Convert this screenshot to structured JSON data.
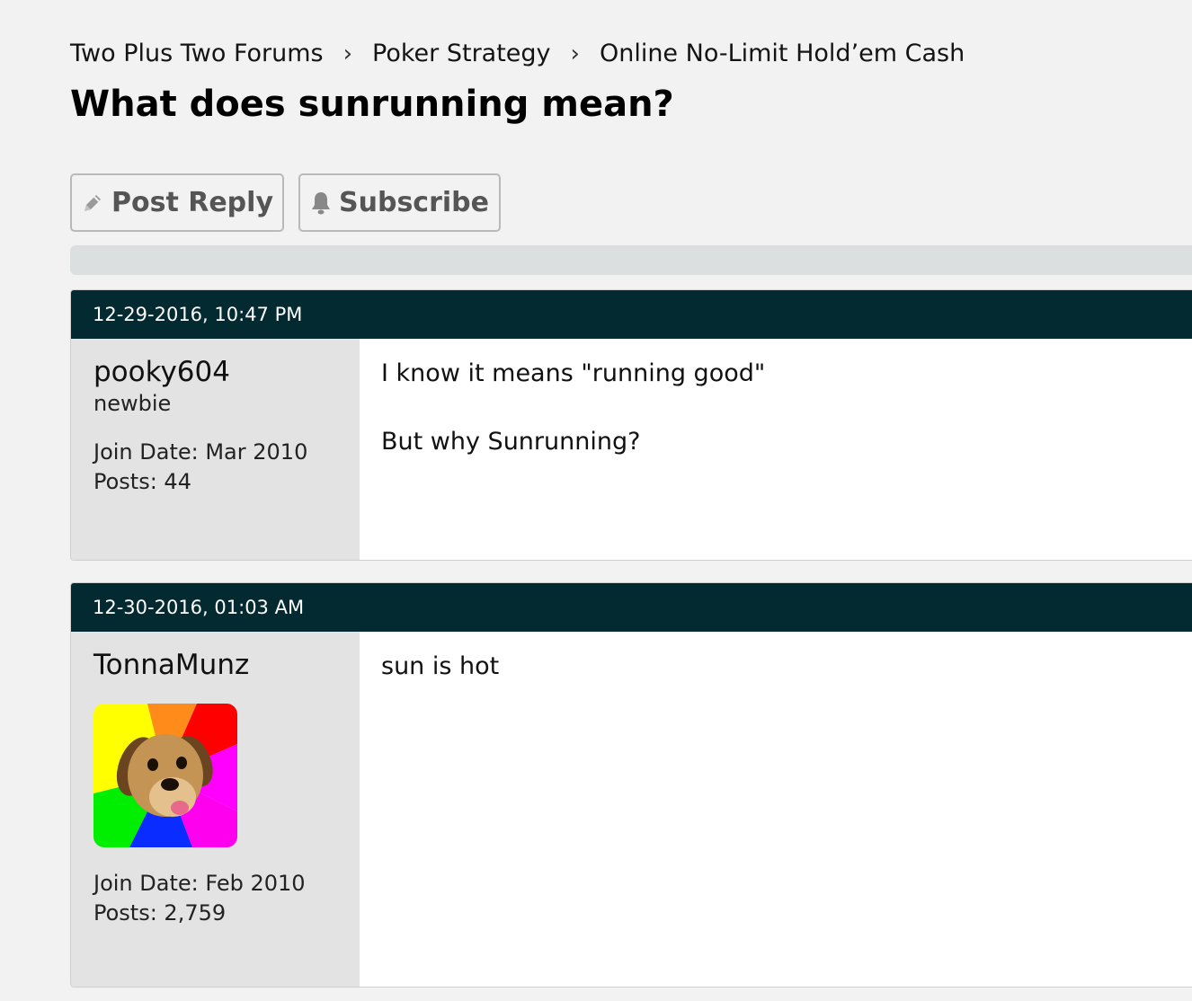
{
  "breadcrumb": {
    "items": [
      "Two Plus Two Forums",
      "Poker Strategy",
      "Online No-Limit Hold’em Cash"
    ],
    "separator": "›"
  },
  "thread": {
    "title": "What does sunrunning mean?"
  },
  "actions": {
    "reply_label": "Post Reply",
    "reply_icon": "pencil-icon",
    "subscribe_label": "Subscribe",
    "subscribe_icon": "bell-icon"
  },
  "colors": {
    "post_header": "#022a30",
    "userinfo_bg": "#e3e3e3",
    "page_bg": "#f2f2f2"
  },
  "posts": [
    {
      "date": "12-29-2016, 10:47 PM",
      "username": "pooky604",
      "usertitle": "newbie",
      "join_date": "Join Date: Mar 2010",
      "posts": "Posts: 44",
      "content": [
        "I know it means \"running good\"",
        "But why Sunrunning?"
      ]
    },
    {
      "date": "12-30-2016, 01:03 AM",
      "username": "TonnaMunz",
      "avatar": "dog-avatar",
      "join_date": "Join Date: Feb 2010",
      "posts": "Posts: 2,759",
      "content": [
        "sun is hot"
      ]
    }
  ]
}
